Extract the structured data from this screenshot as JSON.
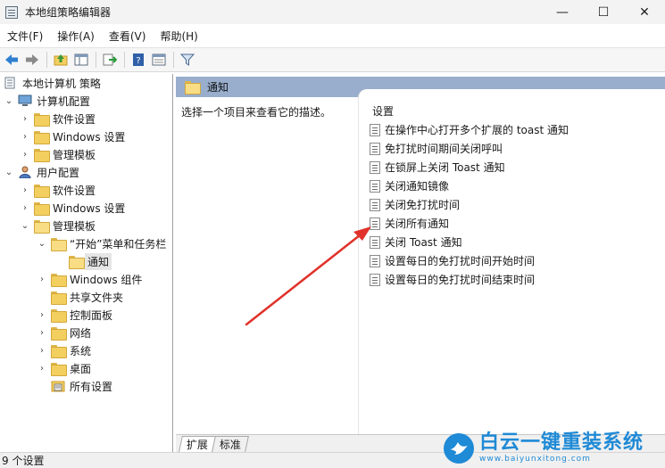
{
  "window": {
    "title": "本地组策略编辑器",
    "minimize": "—",
    "maximize": "☐",
    "close": "✕"
  },
  "menu": [
    "文件(F)",
    "操作(A)",
    "查看(V)",
    "帮助(H)"
  ],
  "tree": {
    "root": "本地计算机 策略",
    "computer_config": "计算机配置",
    "cc_software": "软件设置",
    "cc_windows": "Windows 设置",
    "cc_admin": "管理模板",
    "user_config": "用户配置",
    "uc_software": "软件设置",
    "uc_windows": "Windows 设置",
    "uc_admin": "管理模板",
    "start_menu": "“开始”菜单和任务栏",
    "notifications": "通知",
    "windows_components": "Windows 组件",
    "shared_folders": "共享文件夹",
    "control_panel": "控制面板",
    "network": "网络",
    "system": "系统",
    "desktop": "桌面",
    "all_settings": "所有设置"
  },
  "right": {
    "header_title": "通知",
    "description": "选择一个项目来查看它的描述。",
    "list_header": "设置",
    "policies": [
      "在操作中心打开多个扩展的 toast 通知",
      "免打扰时间期间关闭呼叫",
      "在锁屏上关闭 Toast 通知",
      "关闭通知镜像",
      "关闭免打扰时间",
      "关闭所有通知",
      "关闭 Toast 通知",
      "设置每日的免打扰时间开始时间",
      "设置每日的免打扰时间结束时间"
    ]
  },
  "tabs": [
    "扩展",
    "标准"
  ],
  "status": "9 个设置",
  "watermark": {
    "name": "白云一键重装系统",
    "url": "www.baiyunxitong.com"
  },
  "colors": {
    "header_bg": "#99aecd",
    "arrow": "#e0322b",
    "watermark": "#1f8ad6"
  }
}
